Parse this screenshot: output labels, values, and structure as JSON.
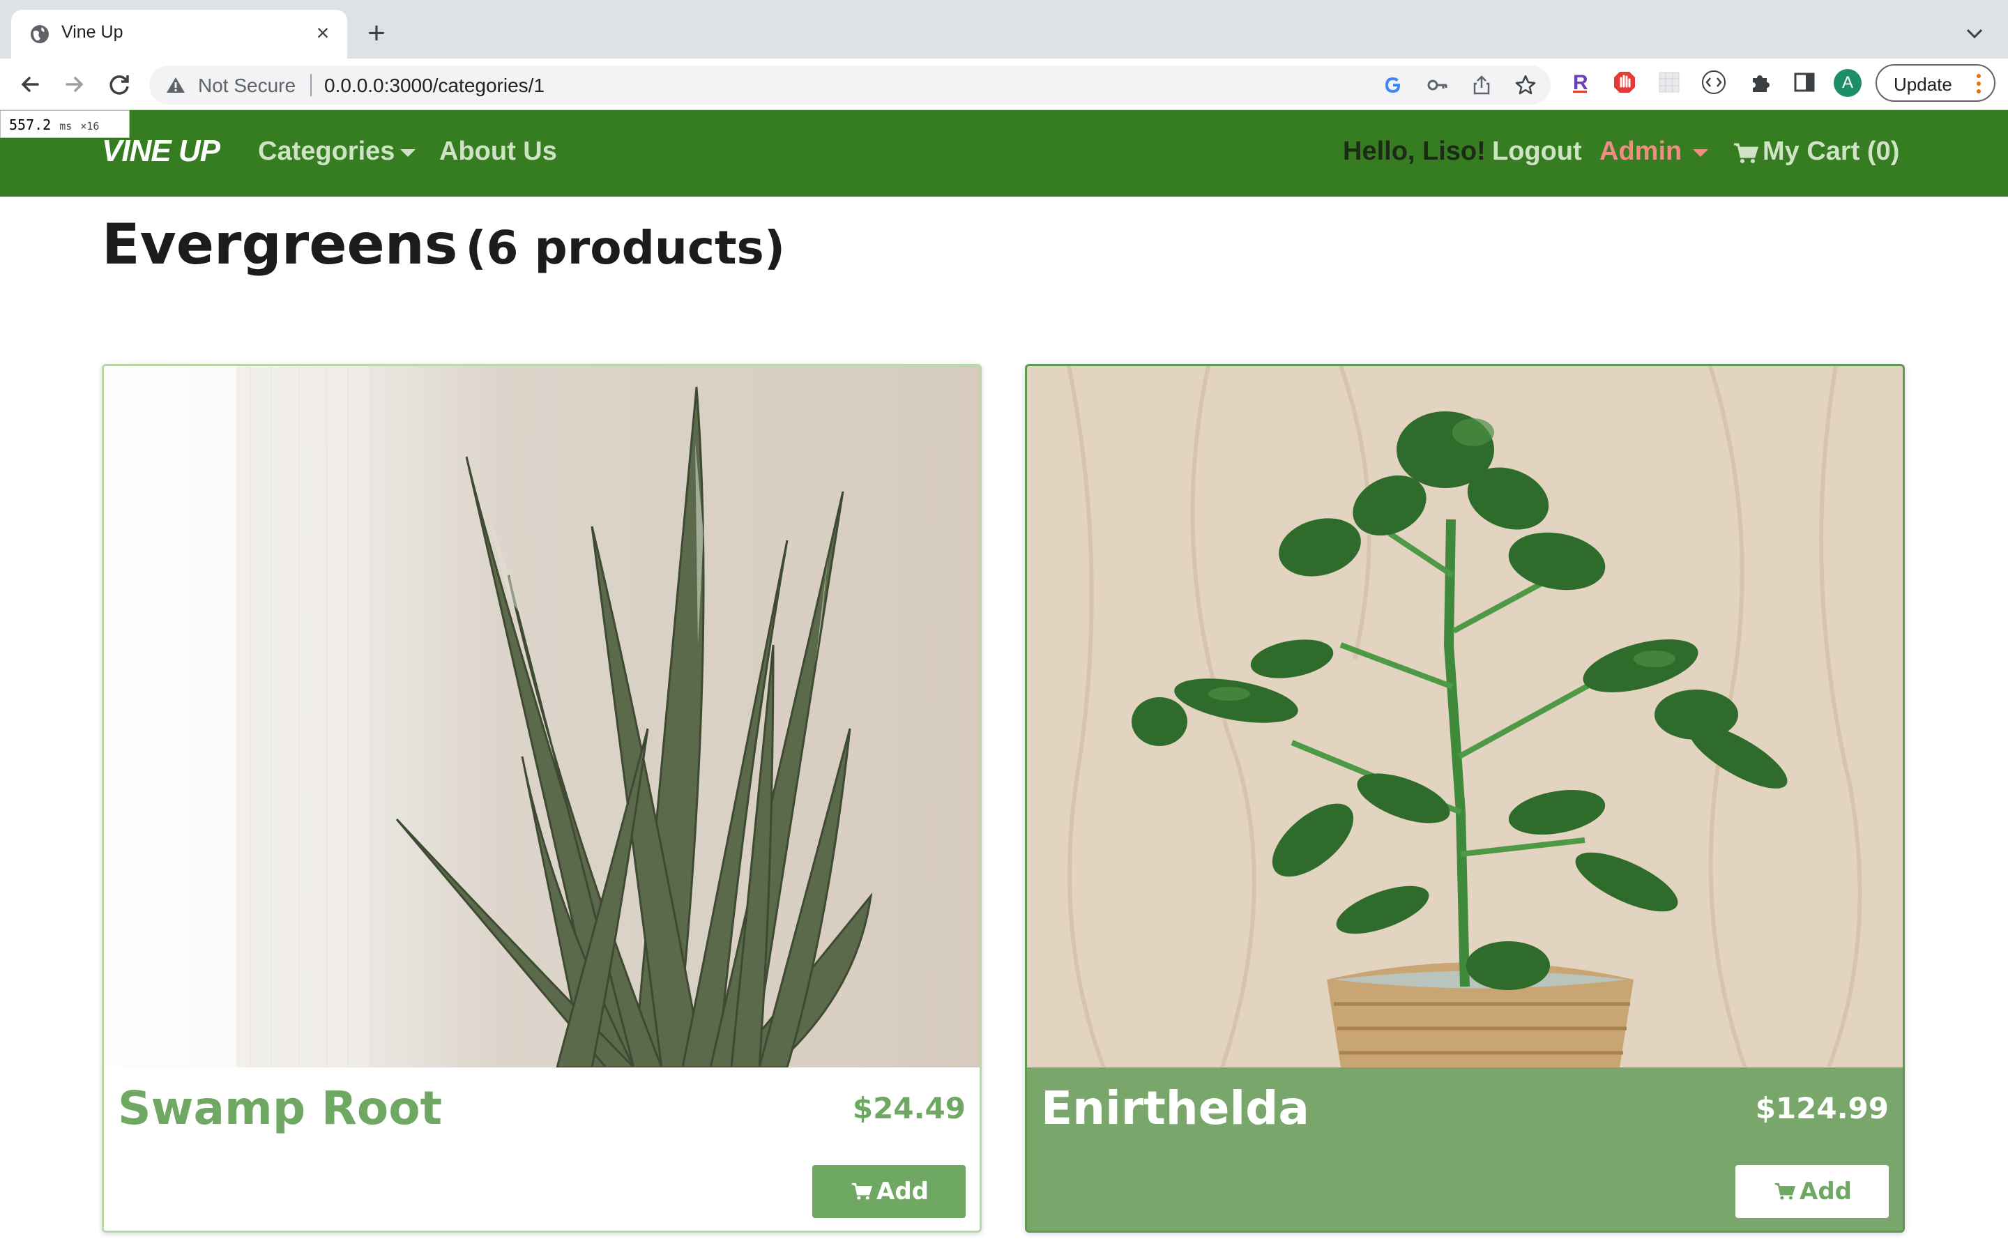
{
  "browser": {
    "tab_title": "Vine Up",
    "address_security": "Not Secure",
    "url": "0.0.0.0:3000/categories/1",
    "update_label": "Update",
    "profile_initial": "A",
    "perf_time": "557.2",
    "perf_unit": "ms",
    "perf_count": "×16"
  },
  "site": {
    "brand": "VINE UP",
    "nav": {
      "categories": "Categories",
      "about": "About Us",
      "greeting": "Hello, Liso!",
      "logout": "Logout",
      "admin": "Admin",
      "cart": "My Cart (0)"
    },
    "colors": {
      "navbar": "#367c21",
      "accent_green": "#6fa862",
      "admin_link": "#f28b82"
    }
  },
  "category": {
    "name": "Evergreens",
    "count_text": "(6 products)"
  },
  "products": [
    {
      "name": "Swamp Root",
      "price": "$24.49",
      "button": "Add",
      "image": "snake-plant-photo"
    },
    {
      "name": "Enirthelda",
      "price": "$124.99",
      "button": "Add",
      "image": "pot-plant-photo"
    }
  ]
}
